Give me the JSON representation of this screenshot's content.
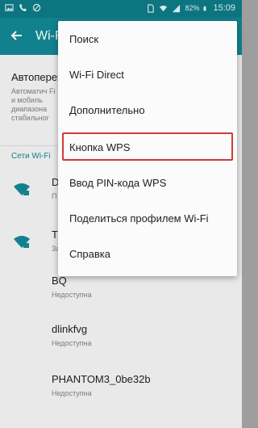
{
  "status_bar": {
    "battery_percent": "82%",
    "time": "15:09",
    "left_icons": [
      "image-icon",
      "phone-icon",
      "blocked-icon"
    ],
    "right_icons": [
      "sim-icon",
      "wifi-icon",
      "signal-icon",
      "battery-icon"
    ]
  },
  "app_bar": {
    "back_icon": "back-arrow-icon",
    "title": "Wi-Fi"
  },
  "settings": {
    "auto_title": "Автоперек",
    "auto_desc": "Автоматич Fi и мобиль диапазона стабильног"
  },
  "networks_header": "Сети Wi-Fi",
  "networks": [
    {
      "name": "D",
      "status": "П",
      "icon": "wifi-secured-icon"
    },
    {
      "name": "T",
      "status": "За",
      "icon": "wifi-secured-icon"
    },
    {
      "name": "BQ",
      "status": "Недоступна",
      "icon": ""
    },
    {
      "name": "dlinkfvg",
      "status": "Недоступна",
      "icon": ""
    },
    {
      "name": "PHANTOM3_0be32b",
      "status": "Недоступна",
      "icon": ""
    }
  ],
  "menu": {
    "items": [
      "Поиск",
      "Wi-Fi Direct",
      "Дополнительно",
      "Кнопка WPS",
      "Ввод PIN-кода WPS",
      "Поделиться профилем Wi-Fi",
      "Справка"
    ],
    "highlighted": "Кнопка WPS",
    "highlight_color": "#cf3a3a"
  },
  "colors": {
    "primary": "#138794",
    "status_bar": "#0d7a86"
  }
}
